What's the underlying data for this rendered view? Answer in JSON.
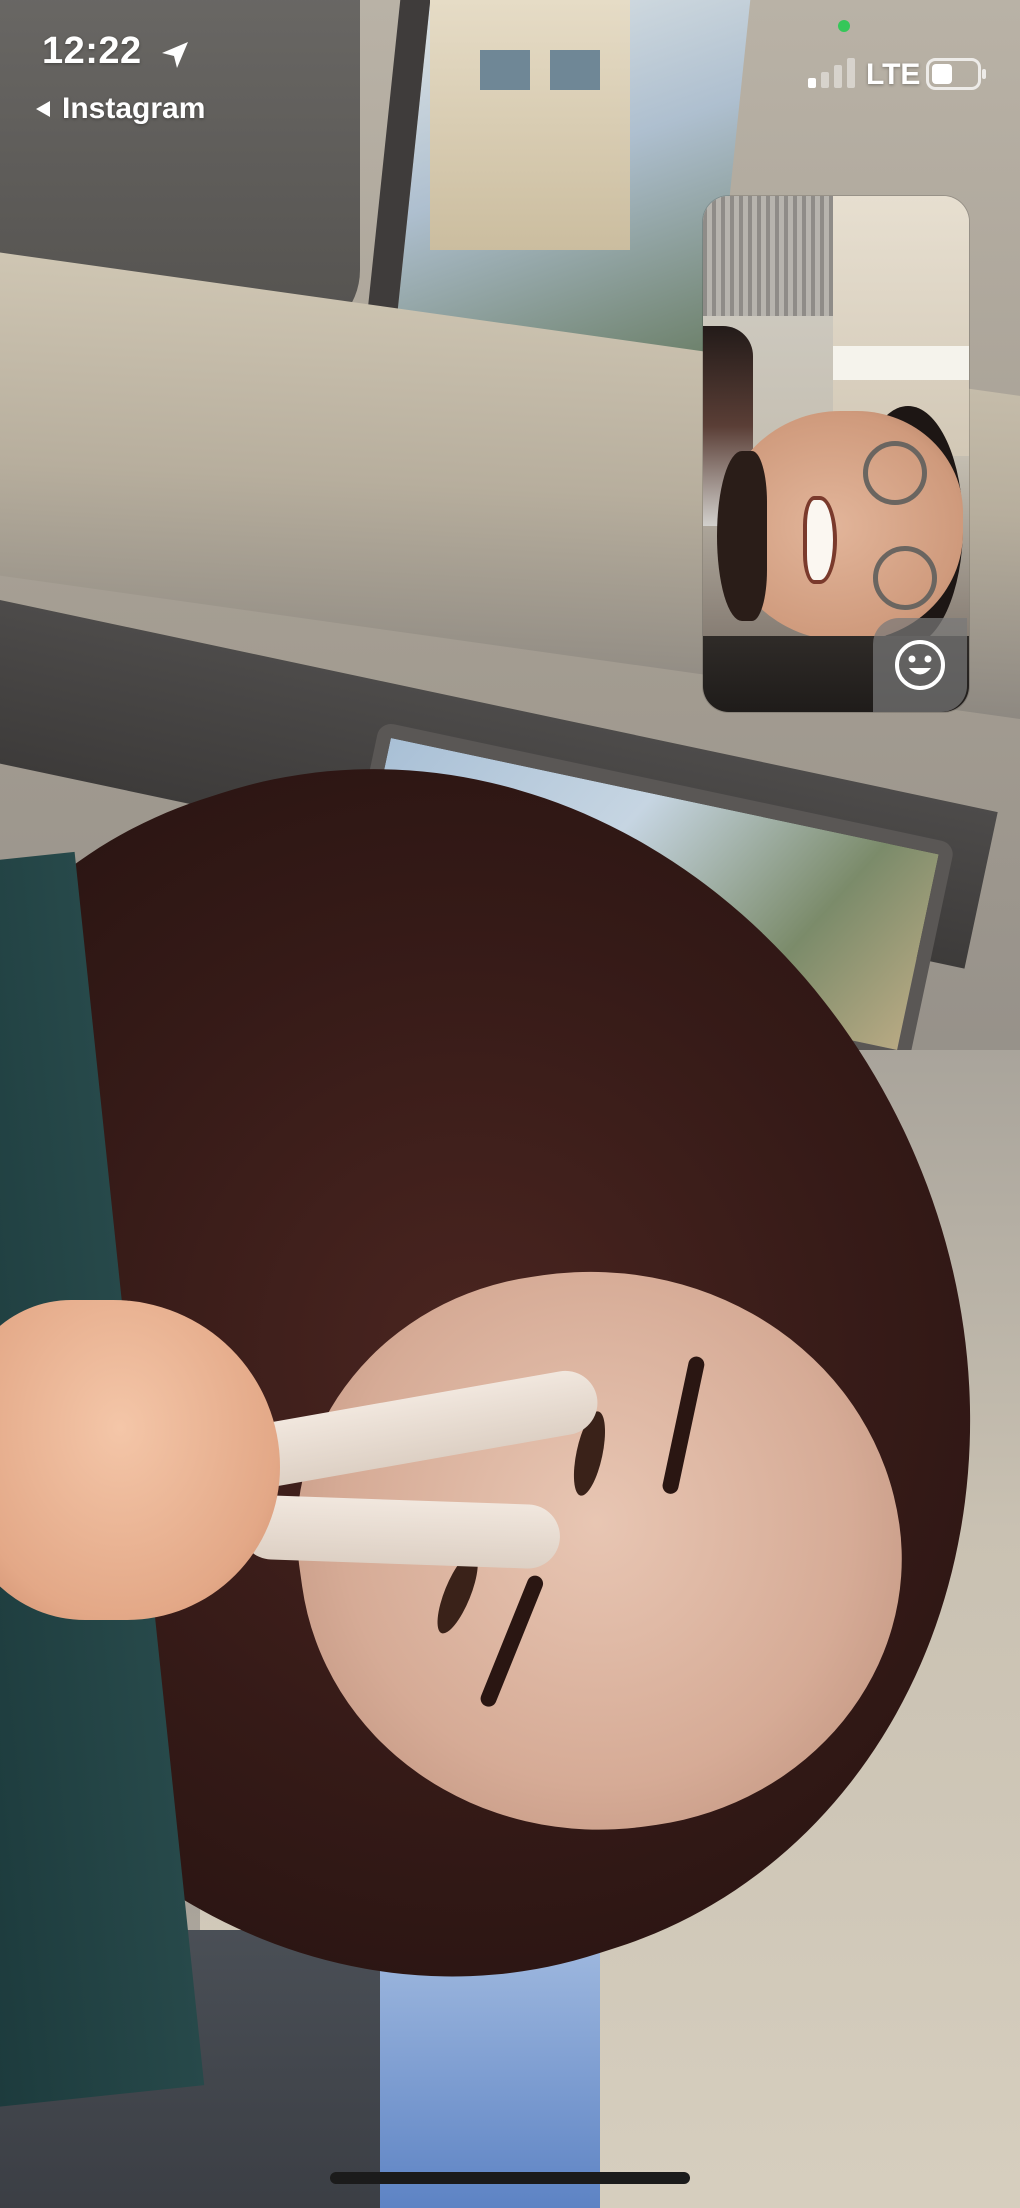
{
  "status_bar": {
    "time": "12:22",
    "back_app": "Instagram",
    "network": "LTE",
    "location_icon": "location-arrow-icon",
    "signal_icon": "cellular-signal-icon",
    "battery_icon": "battery-icon",
    "privacy_indicator_color": "#35c759"
  },
  "call": {
    "self_view_effects_icon": "smiley-face-icon"
  },
  "colors": {
    "status_text": "#ffffff",
    "effects_button_bg": "rgba(120,120,120,0.72)",
    "home_indicator": "#1b1b1b"
  }
}
